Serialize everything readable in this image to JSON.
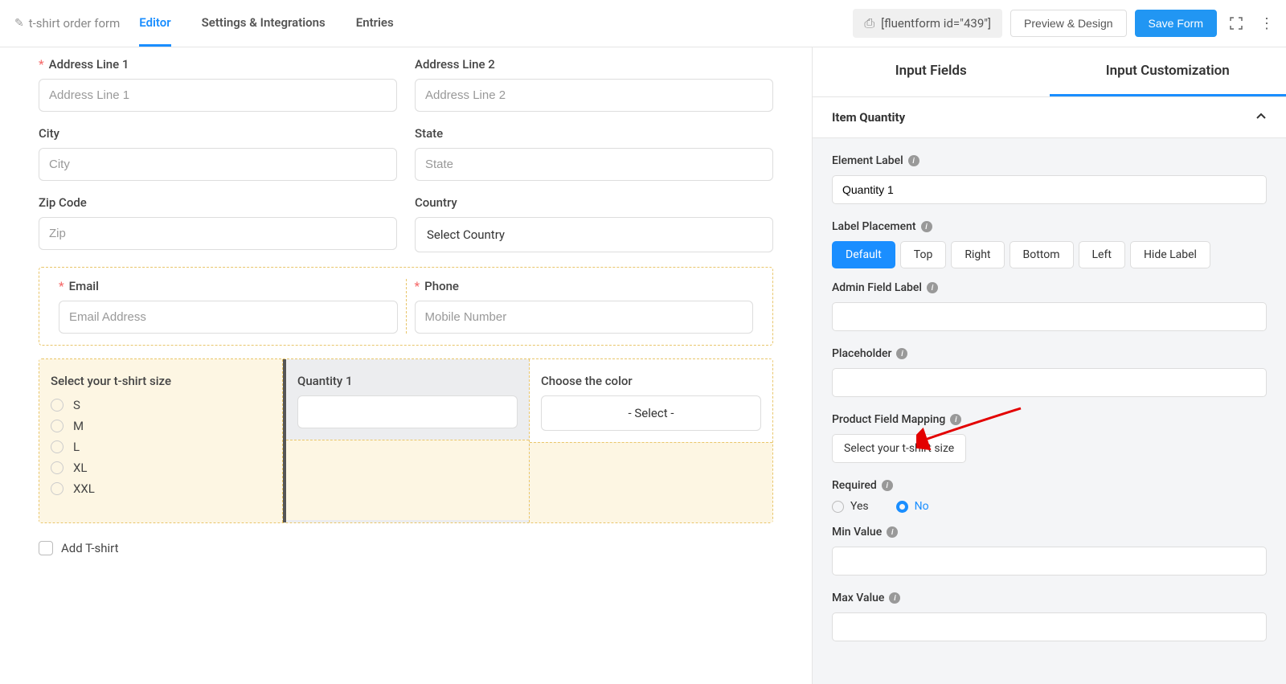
{
  "header": {
    "form_title": "t-shirt order form",
    "tabs": {
      "editor": "Editor",
      "settings": "Settings & Integrations",
      "entries": "Entries"
    },
    "shortcode": "[fluentform id=\"439\"]",
    "preview": "Preview & Design",
    "save": "Save Form"
  },
  "canvas": {
    "addr1": {
      "label": "Address Line 1",
      "placeholder": "Address Line 1"
    },
    "addr2": {
      "label": "Address Line 2",
      "placeholder": "Address Line 2"
    },
    "city": {
      "label": "City",
      "placeholder": "City"
    },
    "state": {
      "label": "State",
      "placeholder": "State"
    },
    "zip": {
      "label": "Zip Code",
      "placeholder": "Zip"
    },
    "country": {
      "label": "Country",
      "value": "Select Country"
    },
    "email": {
      "label": "Email",
      "placeholder": "Email Address"
    },
    "phone": {
      "label": "Phone",
      "placeholder": "Mobile Number"
    },
    "size": {
      "label": "Select your t-shirt size",
      "options": [
        "S",
        "M",
        "L",
        "XL",
        "XXL"
      ]
    },
    "qty": {
      "label": "Quantity 1"
    },
    "color": {
      "label": "Choose the color",
      "value": "- Select -"
    },
    "add_tshirt": "Add T-shirt"
  },
  "sidebar": {
    "tab_fields": "Input Fields",
    "tab_custom": "Input Customization",
    "section_title": "Item Quantity",
    "element_label": {
      "title": "Element Label",
      "value": "Quantity 1"
    },
    "label_placement": {
      "title": "Label Placement",
      "options": [
        "Default",
        "Top",
        "Right",
        "Bottom",
        "Left",
        "Hide Label"
      ]
    },
    "admin_label": {
      "title": "Admin Field Label"
    },
    "placeholder": {
      "title": "Placeholder"
    },
    "product_mapping": {
      "title": "Product Field Mapping",
      "value": "Select your t-shirt size"
    },
    "required": {
      "title": "Required",
      "yes": "Yes",
      "no": "No"
    },
    "min_value": {
      "title": "Min Value"
    },
    "max_value": {
      "title": "Max Value"
    }
  }
}
